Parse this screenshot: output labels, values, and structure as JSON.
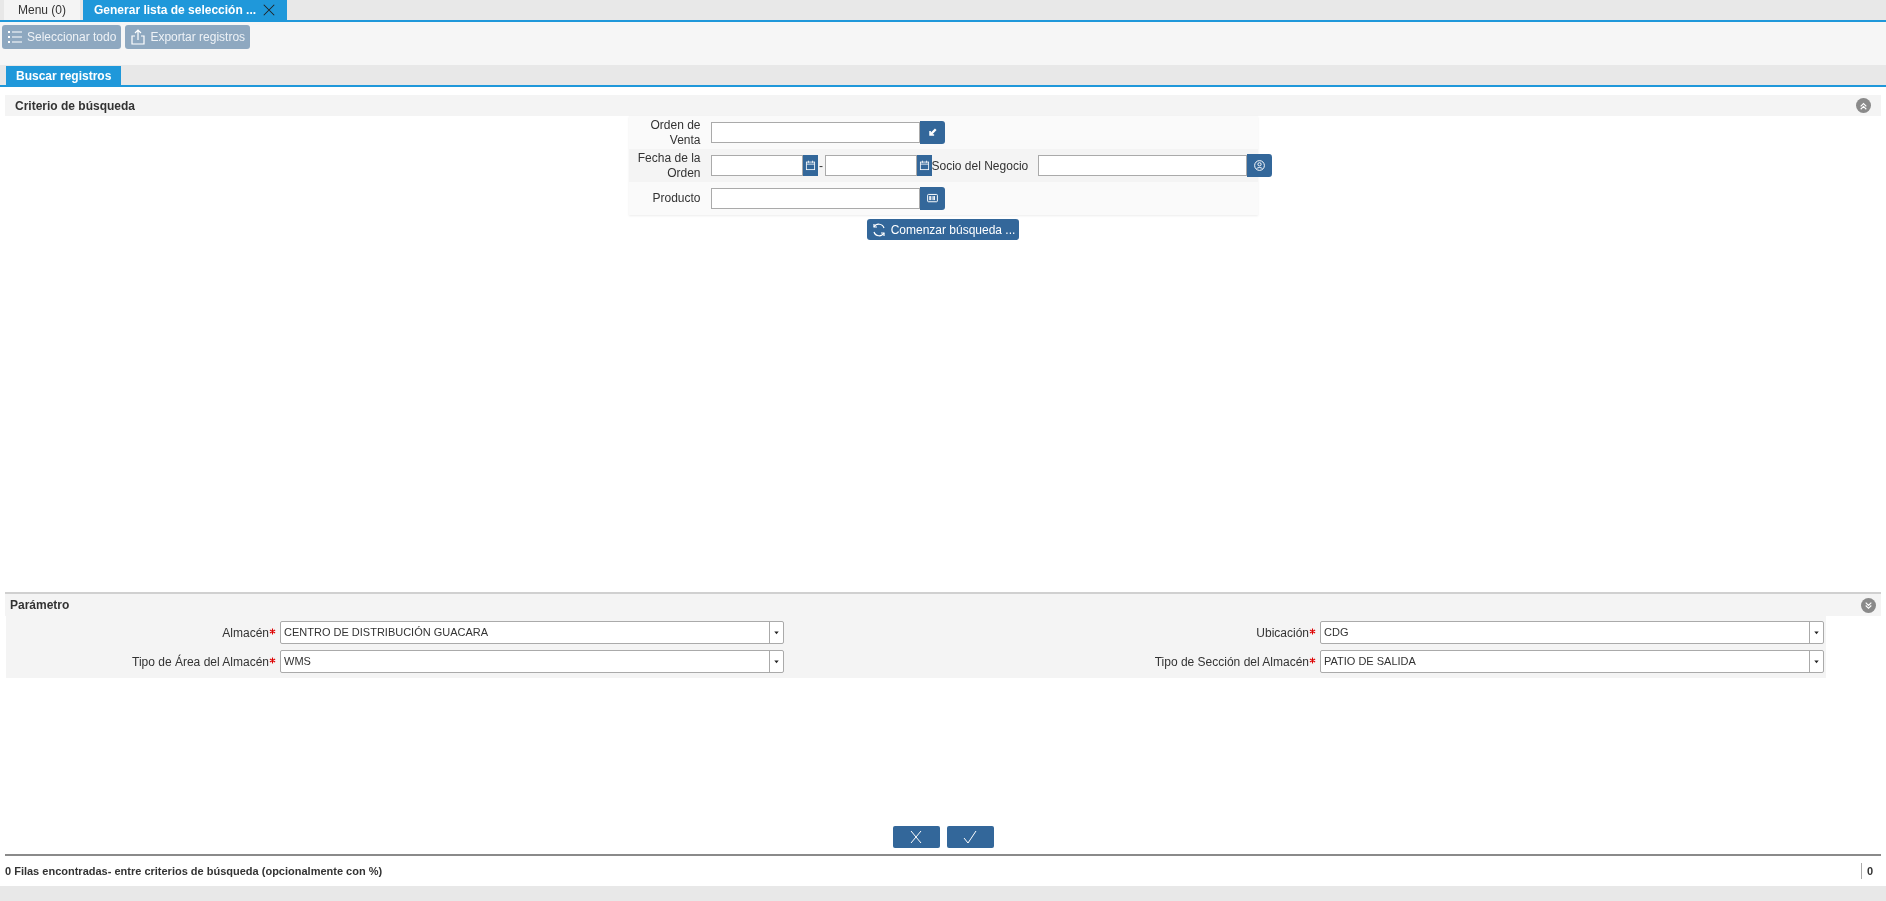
{
  "tabs": [
    {
      "label": "Menu (0)",
      "selected": false,
      "closable": false
    },
    {
      "label": "Generar lista de selección ...",
      "selected": true,
      "closable": true
    }
  ],
  "toolbar": {
    "buttons": [
      {
        "label": "Seleccionar todo",
        "kind": "select_all",
        "disabled": true
      },
      {
        "label": "Exportar registros",
        "kind": "export",
        "disabled": true
      }
    ]
  },
  "subtabs": [
    {
      "label": "Buscar registros",
      "selected": true
    }
  ],
  "search": {
    "title": "Criterio de búsqueda",
    "rows": [
      {
        "left": {
          "label": "Orden de Venta",
          "kind": "order"
        }
      },
      {
        "left": {
          "label": "Fecha de la Orden",
          "kind": "daterange",
          "separator": "-"
        },
        "right": {
          "label": "Socio del Negocio",
          "kind": "person"
        }
      },
      {
        "left": {
          "label": "Producto",
          "kind": "product"
        }
      }
    ],
    "button": "Comenzar búsqueda ..."
  },
  "parameters": {
    "title": "Parámetro",
    "fields": [
      {
        "label": "Almacén",
        "required": true,
        "value": "CENTRO DE DISTRIBUCIÓN GUACARA"
      },
      {
        "label": "Ubicación",
        "required": true,
        "value": "CDG"
      },
      {
        "label": "Tipo de Área del Almacén",
        "required": true,
        "value": "WMS"
      },
      {
        "label": "Tipo de Sección del Almacén",
        "required": true,
        "value": "PATIO DE SALIDA"
      }
    ]
  },
  "actions": [
    {
      "kind": "cancel"
    },
    {
      "kind": "ok"
    }
  ],
  "status_bar": {
    "message": "0 Filas encontradas- entre criterios de búsqueda (opcionalmente con %)",
    "count": "0"
  }
}
